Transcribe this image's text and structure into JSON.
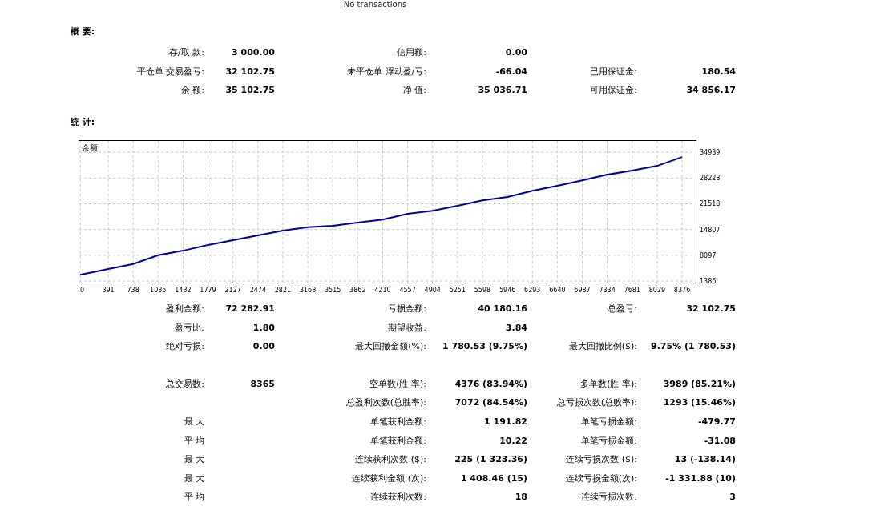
{
  "report": {
    "caption": "No transactions"
  },
  "summary": {
    "title": "概 要:",
    "rows": [
      {
        "left": {
          "label": "存/取 款:",
          "value": "3 000.00"
        },
        "middle": {
          "label": "信用额:",
          "value": "0.00"
        }
      },
      {
        "left": {
          "label": "平仓单 交易盈亏:",
          "value": "32 102.75"
        },
        "middle": {
          "label": "未平仓单 浮动盈/亏:",
          "value": "-66.04"
        },
        "right": {
          "label": "已用保证金:",
          "value": "180.54"
        }
      },
      {
        "left": {
          "label": "余 额:",
          "value": "35 102.75"
        },
        "middle": {
          "label": "净 值:",
          "value": "35 036.71"
        },
        "right": {
          "label": "可用保证金:",
          "value": "34 856.17"
        }
      }
    ]
  },
  "stats": {
    "title": "统 计:",
    "chart_data": {
      "type": "line",
      "grid": true,
      "x": [
        0,
        391,
        738,
        1085,
        1432,
        1779,
        2127,
        2474,
        2821,
        3168,
        3515,
        3862,
        4210,
        4557,
        4904,
        5251,
        5598,
        5946,
        6293,
        6640,
        6987,
        7334,
        7681,
        8029,
        8376
      ],
      "series": [
        {
          "name": "余额",
          "color": "#0000a0",
          "values": [
            3000,
            4500,
            5800,
            8100,
            9300,
            10800,
            12000,
            13300,
            14500,
            15400,
            15800,
            16600,
            17400,
            18900,
            19700,
            21000,
            22400,
            23300,
            24900,
            26200,
            27600,
            29100,
            30200,
            31400,
            33700
          ]
        }
      ],
      "xlim": [
        0,
        8565
      ],
      "ylim": [
        970,
        38100
      ],
      "xticks": [
        0,
        391,
        738,
        1085,
        1432,
        1779,
        2127,
        2474,
        2821,
        3168,
        3515,
        3862,
        4210,
        4557,
        4904,
        5251,
        5598,
        5946,
        6293,
        6640,
        6987,
        7334,
        7681,
        8029,
        8376
      ],
      "yticks": [
        1386,
        8097,
        14807,
        21518,
        28228,
        34939
      ]
    },
    "blocks": [
      [
        {
          "left": {
            "label": "盈利金额:",
            "value": "72 282.91"
          },
          "middle": {
            "label": "亏损金额:",
            "value": "40 180.16"
          },
          "right": {
            "label": "总盈亏:",
            "value": "32 102.75"
          }
        },
        {
          "left": {
            "label": "盈亏比:",
            "value": "1.80"
          },
          "middle": {
            "label": "期望收益:",
            "value": "3.84"
          }
        },
        {
          "left": {
            "label": "绝对亏损:",
            "value": "0.00"
          },
          "middle": {
            "label": "最大回撤金额(%):",
            "value": "1 780.53 (9.75%)"
          },
          "right": {
            "label": "最大回撤比例($):",
            "value": "9.75% (1 780.53)"
          }
        }
      ],
      [
        {
          "left": {
            "label": "总交易数:",
            "value": "8365"
          },
          "middle": {
            "label": "空单数(胜 率):",
            "value": "4376 (83.94%)"
          },
          "right": {
            "label": "多单数(胜 率):",
            "value": "3989 (85.21%)"
          }
        },
        {
          "middle": {
            "label": "总盈利次数(总胜率):",
            "value": "7072 (84.54%)"
          },
          "right": {
            "label": "总亏损次数(总败率):",
            "value": "1293 (15.46%)"
          }
        },
        {
          "heading": "最 大",
          "middle": {
            "label": "单笔获利金额:",
            "value": "1 191.82"
          },
          "right": {
            "label": "单笔亏损金额:",
            "value": "-479.77"
          }
        },
        {
          "heading": "平 均",
          "middle": {
            "label": "单笔获利金额:",
            "value": "10.22"
          },
          "right": {
            "label": "单笔亏损金额:",
            "value": "-31.08"
          }
        },
        {
          "heading": "最 大",
          "middle": {
            "label": "连续获利次数 ($):",
            "value": "225 (1 323.36)"
          },
          "right": {
            "label": "连续亏损次数 ($):",
            "value": "13 (-138.14)"
          }
        },
        {
          "heading": "最 大",
          "middle": {
            "label": "连续获利金额 (次):",
            "value": "1 408.46 (15)"
          },
          "right": {
            "label": "连续亏损金额(次):",
            "value": "-1 331.88 (10)"
          }
        },
        {
          "heading": "平 均",
          "middle": {
            "label": "连续获利次数:",
            "value": "18"
          },
          "right": {
            "label": "连续亏损次数:",
            "value": "3"
          }
        }
      ]
    ]
  }
}
